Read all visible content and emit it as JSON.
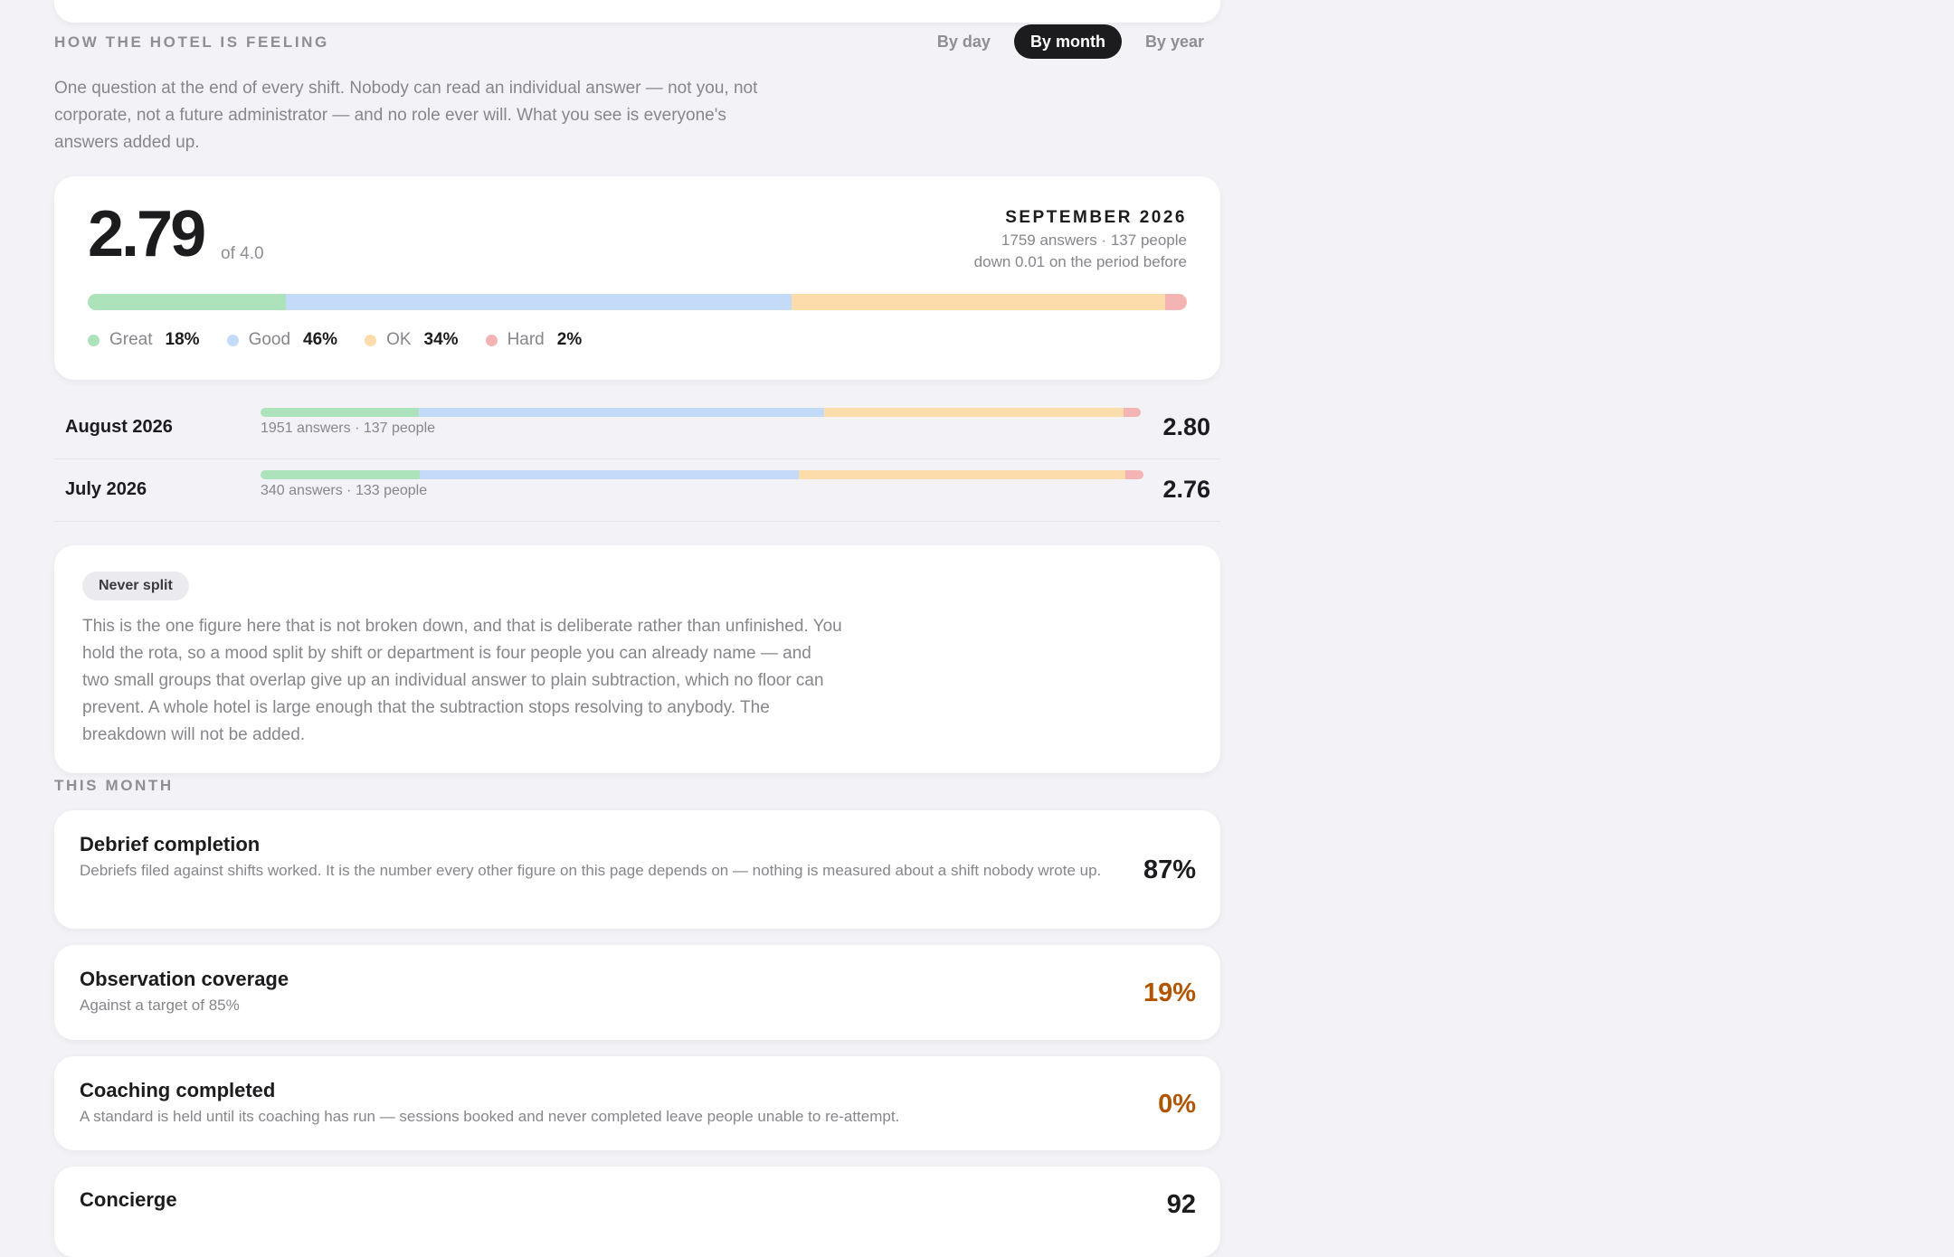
{
  "section": {
    "title": "How the hotel is feeling",
    "intro": "One question at the end of every shift. Nobody can read an individual answer — not you, not corporate, not a future administrator — and no role ever will. What you see is everyone's answers added up."
  },
  "view_toggle": {
    "options": [
      "By day",
      "By month",
      "By year"
    ],
    "selected": "By month"
  },
  "colors": {
    "great": "#ace3bb",
    "good": "#c3daf9",
    "ok": "#fcdcab",
    "hard": "#f3b4b3",
    "warning": "#b25400"
  },
  "summary": {
    "score": "2.79",
    "out_of": "of 4.0",
    "period": "SEPTEMBER 2026",
    "counts": "1759 answers · 137 people",
    "change": "down 0.01 on the period before",
    "distribution": [
      {
        "label": "Great",
        "percent": 18,
        "percent_label": "18%"
      },
      {
        "label": "Good",
        "percent": 46,
        "percent_label": "46%"
      },
      {
        "label": "OK",
        "percent": 34,
        "percent_label": "34%"
      },
      {
        "label": "Hard",
        "percent": 2,
        "percent_label": "2%"
      }
    ]
  },
  "history": [
    {
      "period": "August 2026",
      "counts": "1951 answers · 137 people",
      "score": "2.80",
      "distribution": [
        18,
        46,
        34,
        2
      ]
    },
    {
      "period": "July 2026",
      "counts": "340 answers · 133 people",
      "score": "2.76",
      "distribution": [
        18,
        43,
        37,
        2
      ]
    }
  ],
  "note": {
    "badge": "Never split",
    "text": "This is the one figure here that is not broken down, and that is deliberate rather than unfinished. You hold the rota, so a mood split by shift or department is four people you can already name — and two small groups that overlap give up an individual answer to plain subtraction, which no floor can prevent. A whole hotel is large enough that the subtraction stops resolving to anybody. The breakdown will not be added."
  },
  "this_month": {
    "title": "This month",
    "metrics": [
      {
        "title": "Debrief completion",
        "description": "Debriefs filed against shifts worked. It is the number every other figure on this page depends on — nothing is measured about a shift nobody wrote up.",
        "value": "87%",
        "status": "normal"
      },
      {
        "title": "Observation coverage",
        "description": "Against a target of 85%",
        "value": "19%",
        "status": "warning"
      },
      {
        "title": "Coaching completed",
        "description": "A standard is held until its coaching has run — sessions booked and never completed leave people unable to re-attempt.",
        "value": "0%",
        "status": "warning"
      },
      {
        "title": "Concierge",
        "description": "",
        "value": "92",
        "status": "normal"
      }
    ]
  }
}
